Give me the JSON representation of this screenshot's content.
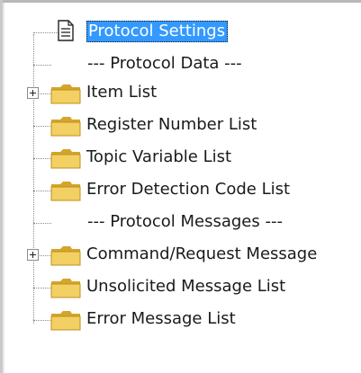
{
  "tree": {
    "items": [
      {
        "label": "Protocol Settings",
        "icon": "document-icon",
        "selected": true
      },
      {
        "label": "--- Protocol Data ---",
        "icon": null
      },
      {
        "label": "Item List",
        "icon": "folder-icon",
        "expandable": true
      },
      {
        "label": "Register Number List",
        "icon": "folder-icon"
      },
      {
        "label": "Topic Variable List",
        "icon": "folder-icon"
      },
      {
        "label": "Error Detection Code List",
        "icon": "folder-icon"
      },
      {
        "label": "--- Protocol Messages ---",
        "icon": null
      },
      {
        "label": "Command/Request Message",
        "icon": "folder-icon",
        "expandable": true
      },
      {
        "label": "Unsolicited Message List",
        "icon": "folder-icon"
      },
      {
        "label": "Error Message List",
        "icon": "folder-icon"
      }
    ]
  },
  "colors": {
    "selection": "#3399ff",
    "folder": "#e6c34a",
    "lines": "#8a8a8a"
  }
}
